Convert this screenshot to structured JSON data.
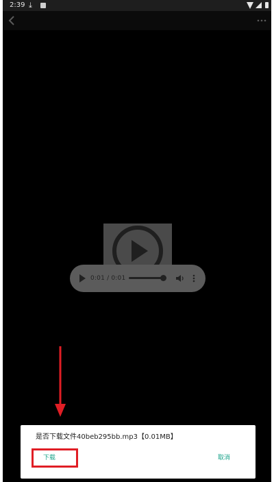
{
  "status_bar": {
    "time": "2:39",
    "icons": [
      "download-icon",
      "photo-icon",
      "wifi-icon",
      "signal-icon",
      "battery-icon"
    ]
  },
  "toolbar": {
    "back_icon": "back-arrow-icon",
    "more_icon": "more-icon"
  },
  "audio_player": {
    "time": "0:01 / 0:01",
    "progress": 1.0
  },
  "dialog": {
    "message": "是否下载文件40beb295bb.mp3【0.01MB】",
    "download_label": "下载",
    "cancel_label": "取消"
  },
  "colors": {
    "accent": "#1aa38a",
    "annotation_red": "#e01e25",
    "background": "#000000"
  }
}
